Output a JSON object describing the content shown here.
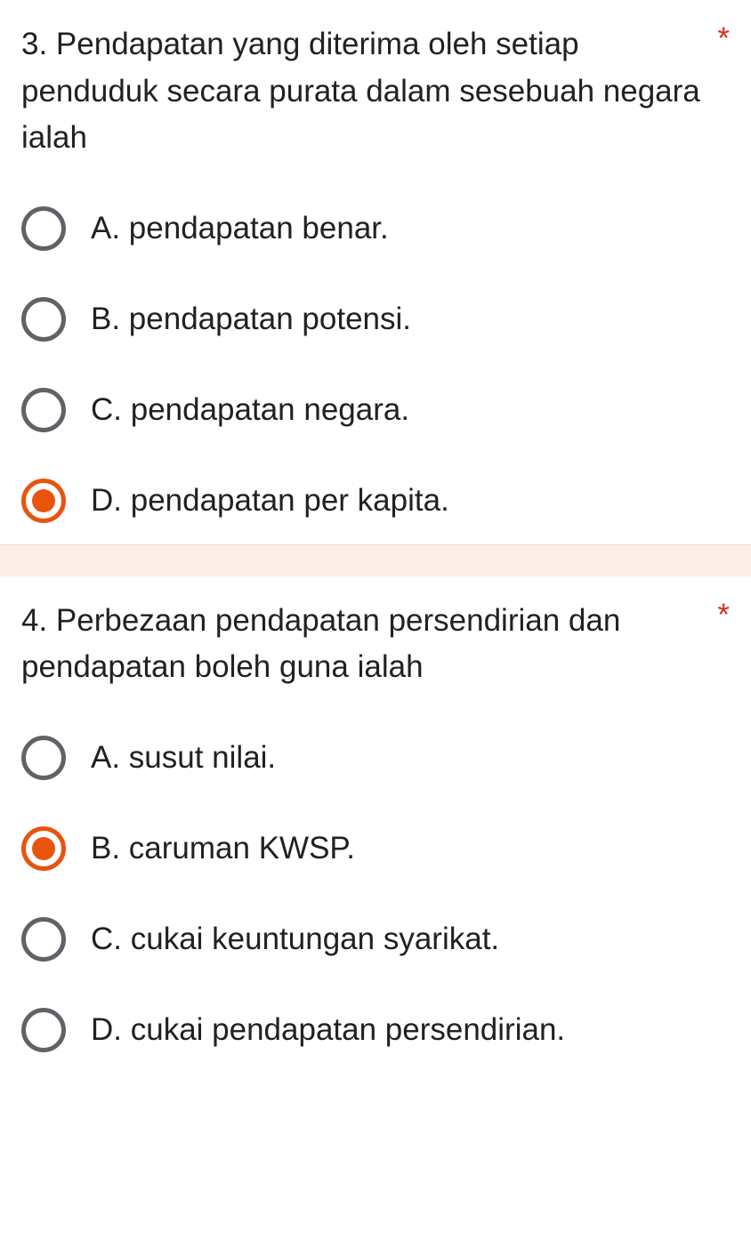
{
  "questions": [
    {
      "text": "3. Pendapatan yang diterima oleh setiap penduduk secara purata dalam sesebuah negara ialah",
      "required": "*",
      "options": [
        {
          "label": "A.  pendapatan benar.",
          "selected": false
        },
        {
          "label": "B.  pendapatan potensi.",
          "selected": false
        },
        {
          "label": "C.  pendapatan negara.",
          "selected": false
        },
        {
          "label": "D.  pendapatan per kapita.",
          "selected": true
        }
      ]
    },
    {
      "text": "4. Perbezaan pendapatan persendirian dan pendapatan boleh guna ialah",
      "required": "*",
      "options": [
        {
          "label": "A.  susut nilai.",
          "selected": false
        },
        {
          "label": "B.  caruman KWSP.",
          "selected": true
        },
        {
          "label": "C.  cukai keuntungan syarikat.",
          "selected": false
        },
        {
          "label": "D.  cukai pendapatan persendirian.",
          "selected": false
        }
      ]
    }
  ]
}
